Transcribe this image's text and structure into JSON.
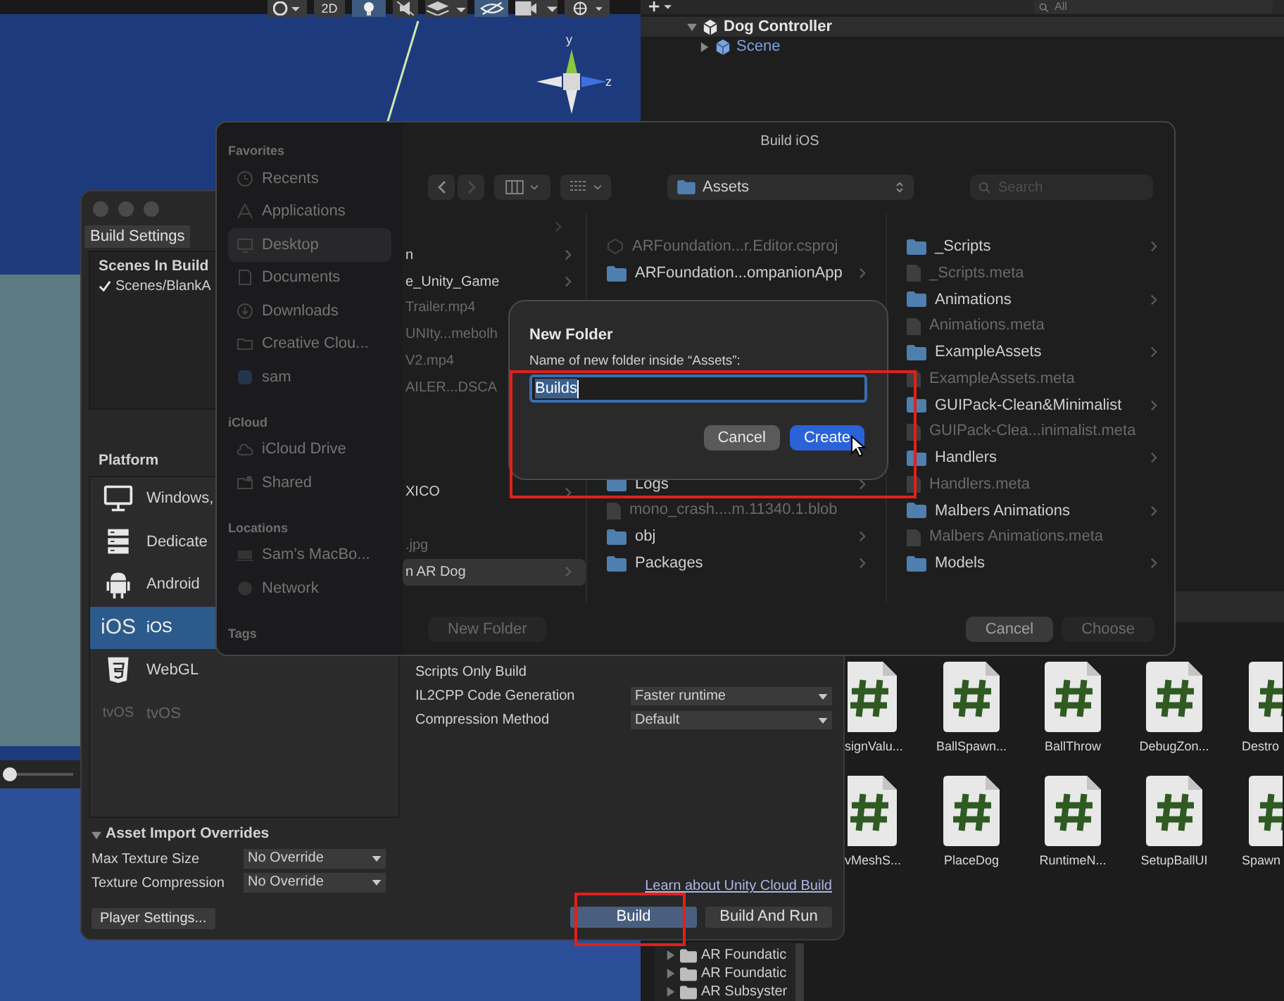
{
  "scene_toolbar": {
    "tools": [
      {
        "kind": "shading",
        "on": false
      },
      {
        "kind": "mode",
        "label": "2D",
        "on": false
      },
      {
        "kind": "lighting",
        "on": true
      },
      {
        "kind": "audio",
        "on": false
      },
      {
        "kind": "effects",
        "on": false
      },
      {
        "kind": "visibility",
        "on": true
      },
      {
        "kind": "camera",
        "on": false
      },
      {
        "kind": "gizmos",
        "on": false
      }
    ]
  },
  "scene_view": {
    "gizmo_labels": [
      "y",
      "z"
    ],
    "slider": {
      "level": 0
    }
  },
  "hierarchy": {
    "search": {
      "placeholder": "All"
    },
    "items": [
      {
        "label": "Dog Controller",
        "expanded": true,
        "children": [
          {
            "label": "Scene",
            "expanded": false
          }
        ]
      }
    ]
  },
  "project": {
    "tree": [
      {
        "label": "AR Foundatic",
        "expanded": false
      },
      {
        "label": "AR Foundatic",
        "expanded": false
      },
      {
        "label": "AR Subsyster",
        "expanded": false
      }
    ],
    "scripts": [
      {
        "label": "signValu..."
      },
      {
        "label": "BallSpawn..."
      },
      {
        "label": "BallThrow"
      },
      {
        "label": "DebugZon..."
      },
      {
        "label": "Destro"
      },
      {
        "label": "vMeshS..."
      },
      {
        "label": "PlaceDog"
      },
      {
        "label": "RuntimeN..."
      },
      {
        "label": "SetupBallUI"
      },
      {
        "label": "Spawn"
      }
    ]
  },
  "build_settings": {
    "title": "Build Settings",
    "scenes_heading": "Scenes In Build",
    "scenes": [
      {
        "label": "Scenes/BlankA",
        "checked": true
      }
    ],
    "platform_heading": "Platform",
    "platforms": [
      {
        "kind": "windows",
        "label": "Windows,",
        "selected": false,
        "disabled": false
      },
      {
        "kind": "server",
        "label": "Dedicate",
        "selected": false,
        "disabled": false
      },
      {
        "kind": "android",
        "label": "Android",
        "selected": false,
        "disabled": false
      },
      {
        "kind": "ios",
        "icon_text": "iOS",
        "label": "iOS",
        "selected": true,
        "disabled": false
      },
      {
        "kind": "webgl",
        "label": "WebGL",
        "selected": false,
        "disabled": false
      },
      {
        "kind": "tvos",
        "icon_text": "tvOS",
        "label": "tvOS",
        "selected": false,
        "disabled": true
      }
    ],
    "settings": [
      {
        "label": "Scripts Only Build"
      },
      {
        "label": "IL2CPP Code Generation",
        "value": "Faster runtime"
      },
      {
        "label": "Compression Method",
        "value": "Default"
      }
    ],
    "asset_import_overrides": {
      "title": "Asset Import Overrides",
      "expanded": true,
      "fields": [
        {
          "label": "Max Texture Size",
          "value": "No Override"
        },
        {
          "label": "Texture Compression",
          "value": "No Override"
        }
      ]
    },
    "player_settings_button": "Player Settings...",
    "cloud_build_link": "Learn about Unity Cloud Build",
    "buttons": [
      {
        "label": "Build",
        "primary": true
      },
      {
        "label": "Build And Run",
        "primary": false
      }
    ]
  },
  "file_dialog": {
    "title": "Build iOS",
    "location": "Assets",
    "search": {
      "placeholder": "Search"
    },
    "sidebar": [
      {
        "heading": "Favorites",
        "items": [
          {
            "kind": "recents",
            "label": "Recents",
            "selected": false
          },
          {
            "kind": "applications",
            "label": "Applications",
            "selected": false
          },
          {
            "kind": "desktop",
            "label": "Desktop",
            "selected": true
          },
          {
            "kind": "documents",
            "label": "Documents",
            "selected": false
          },
          {
            "kind": "downloads",
            "label": "Downloads",
            "selected": false
          },
          {
            "kind": "folder",
            "label": "Creative Clou...",
            "selected": false
          },
          {
            "kind": "home",
            "label": "sam",
            "selected": false
          }
        ]
      },
      {
        "heading": "iCloud",
        "items": [
          {
            "kind": "cloud",
            "label": "iCloud Drive",
            "selected": false
          },
          {
            "kind": "shared",
            "label": "Shared",
            "selected": false
          }
        ]
      },
      {
        "heading": "Locations",
        "items": [
          {
            "kind": "computer",
            "label": "Sam’s MacBo...",
            "selected": false
          },
          {
            "kind": "network",
            "label": "Network",
            "selected": false
          }
        ]
      },
      {
        "heading": "Tags"
      }
    ],
    "columns": [
      {
        "groups": [
          [
            {
              "kind": "folder",
              "label": "n",
              "selected": false
            },
            {
              "kind": "folder",
              "label": "e_Unity_Game",
              "selected": false
            },
            {
              "kind": "file",
              "label": "Trailer.mp4",
              "selected": false
            },
            {
              "kind": "file",
              "label": "UNIty...mebolh",
              "selected": false
            },
            {
              "kind": "file",
              "label": "V2.mp4",
              "selected": false
            },
            {
              "kind": "file",
              "label": "AILER...DSCA",
              "selected": false
            }
          ],
          [
            {
              "kind": "folder",
              "label": "XICO",
              "selected": false
            }
          ],
          [
            {
              "kind": "file",
              "label": ".jpg",
              "selected": false
            },
            {
              "kind": "folder",
              "label": "n AR Dog",
              "selected": true
            }
          ]
        ]
      },
      {
        "groups": [
          [
            {
              "kind": "project",
              "label": "ARFoundation...r.Editor.csproj",
              "selected": false
            },
            {
              "kind": "folder",
              "label": "ARFoundation...ompanionApp",
              "selected": false
            }
          ],
          [
            {
              "kind": "folder",
              "label": "Logs",
              "selected": false
            },
            {
              "kind": "file",
              "label": "mono_crash....m.11340.1.blob",
              "selected": false
            },
            {
              "kind": "folder",
              "label": "obj",
              "selected": false
            },
            {
              "kind": "folder",
              "label": "Packages",
              "selected": false
            }
          ]
        ]
      },
      {
        "groups": [
          [
            {
              "kind": "folder",
              "label": "_Scripts",
              "selected": false
            },
            {
              "kind": "file",
              "label": "_Scripts.meta",
              "selected": false
            },
            {
              "kind": "folder",
              "label": "Animations",
              "selected": false
            },
            {
              "kind": "file",
              "label": "Animations.meta",
              "selected": false
            },
            {
              "kind": "folder",
              "label": "ExampleAssets",
              "selected": false
            },
            {
              "kind": "file",
              "label": "ExampleAssets.meta",
              "selected": false
            },
            {
              "kind": "folder",
              "label": "GUIPack-Clean&Minimalist",
              "selected": false
            },
            {
              "kind": "file",
              "label": "GUIPack-Clea...inimalist.meta",
              "selected": false
            },
            {
              "kind": "folder",
              "label": "Handlers",
              "selected": false
            },
            {
              "kind": "file",
              "label": "Handlers.meta",
              "selected": false
            },
            {
              "kind": "folder",
              "label": "Malbers Animations",
              "selected": false
            },
            {
              "kind": "file",
              "label": "Malbers Animations.meta",
              "selected": false
            },
            {
              "kind": "folder",
              "label": "Models",
              "selected": false
            }
          ]
        ]
      }
    ],
    "buttons": [
      {
        "label": "New Folder",
        "disabled": true
      },
      {
        "label": "Cancel",
        "disabled": false
      },
      {
        "label": "Choose",
        "disabled": true
      }
    ]
  },
  "new_folder_sheet": {
    "title": "New Folder",
    "prompt": "Name of new folder inside “Assets”:",
    "value": "Builds",
    "buttons": [
      {
        "label": "Cancel",
        "primary": false
      },
      {
        "label": "Create",
        "primary": true
      }
    ]
  }
}
